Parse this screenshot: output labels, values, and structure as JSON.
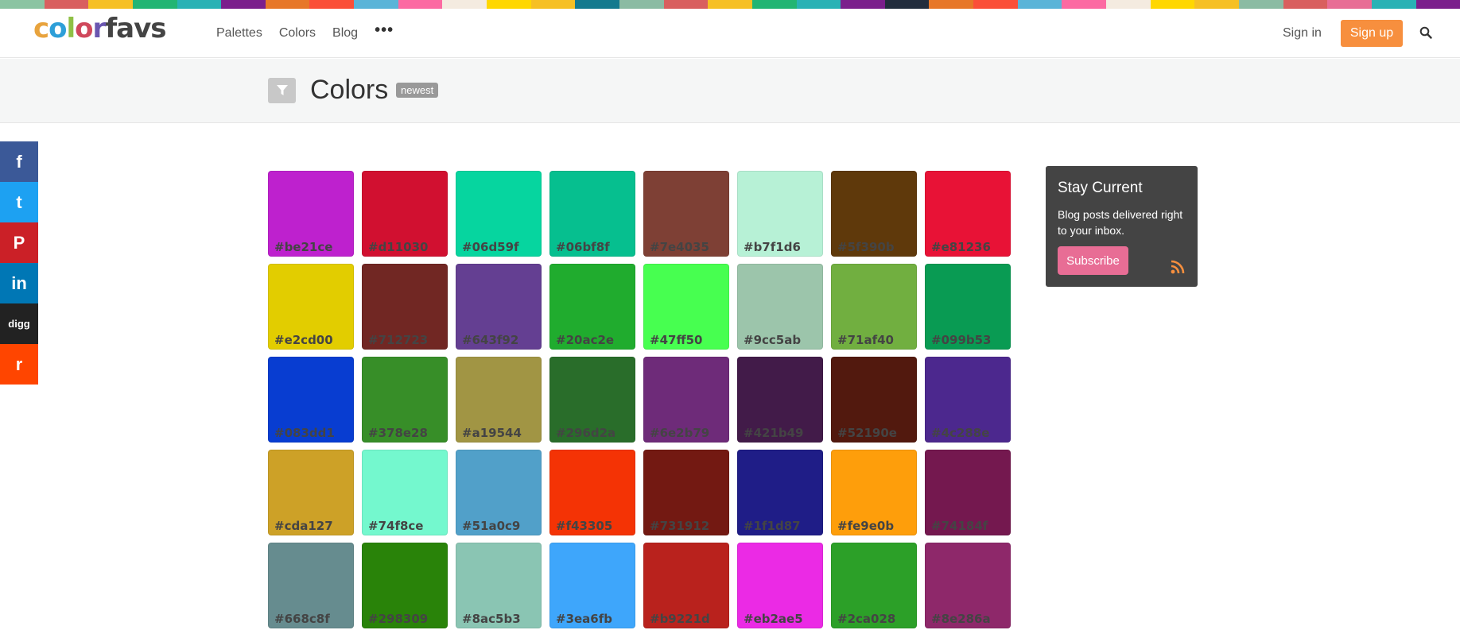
{
  "stripe_colors": [
    "#8bc4a2",
    "#d95f5f",
    "#f6c024",
    "#22b573",
    "#29b2b5",
    "#7b1f8c",
    "#e77728",
    "#fb4f38",
    "#5ab4d8",
    "#fc6aa2",
    "#f4ebe0",
    "#ffd700",
    "#f6c024",
    "#147a8e",
    "#8bbba3",
    "#d95f5f",
    "#f6c024",
    "#22b573",
    "#29b2b5",
    "#7b1f8c",
    "#222d3d",
    "#e77728",
    "#fb4f38",
    "#5ab4d8",
    "#fc6aa2",
    "#f4ebe0",
    "#ffd700",
    "#f6c024",
    "#8bbba3",
    "#d95f5f",
    "#e86d95",
    "#29b2b5",
    "#7b1f8c"
  ],
  "logo": {
    "letters": [
      {
        "ch": "c",
        "color": "#e8a33d"
      },
      {
        "ch": "o",
        "color": "#2e9fd8"
      },
      {
        "ch": "l",
        "color": "#8fc045"
      },
      {
        "ch": "o",
        "color": "#d0485c"
      },
      {
        "ch": "r",
        "color": "#6a56b0"
      },
      {
        "ch": "f",
        "color": "#444444"
      },
      {
        "ch": "a",
        "color": "#444444"
      },
      {
        "ch": "v",
        "color": "#444444"
      },
      {
        "ch": "s",
        "color": "#444444"
      }
    ]
  },
  "nav": {
    "palettes": "Palettes",
    "colors": "Colors",
    "blog": "Blog",
    "more": "•••",
    "signin": "Sign in",
    "signup": "Sign up",
    "search_icon": "search-icon"
  },
  "header": {
    "title": "Colors",
    "badge": "newest",
    "filter_icon": "filter-icon"
  },
  "social": [
    {
      "name": "facebook",
      "glyph": "f",
      "color": "#3b5998"
    },
    {
      "name": "twitter",
      "glyph": "t",
      "color": "#1da1f2"
    },
    {
      "name": "pinterest",
      "glyph": "P",
      "color": "#cb2027"
    },
    {
      "name": "linkedin",
      "glyph": "in",
      "color": "#0077b5"
    },
    {
      "name": "digg",
      "glyph": "digg",
      "color": "#222222"
    },
    {
      "name": "reddit",
      "glyph": "r",
      "color": "#ff4500"
    }
  ],
  "colors": [
    {
      "hex": "#be21ce",
      "label": "#be21ce"
    },
    {
      "hex": "#d11030",
      "label": "#d11030"
    },
    {
      "hex": "#06d59f",
      "label": "#06d59f"
    },
    {
      "hex": "#06bf8f",
      "label": "#06bf8f"
    },
    {
      "hex": "#7e4035",
      "label": "#7e4035"
    },
    {
      "hex": "#b7f1d6",
      "label": "#b7f1d6"
    },
    {
      "hex": "#5f390b",
      "label": "#5f390b"
    },
    {
      "hex": "#e81236",
      "label": "#e81236"
    },
    {
      "hex": "#e2cd00",
      "label": "#e2cd00"
    },
    {
      "hex": "#712723",
      "label": "#712723"
    },
    {
      "hex": "#643f92",
      "label": "#643f92"
    },
    {
      "hex": "#20ac2e",
      "label": "#20ac2e"
    },
    {
      "hex": "#47ff50",
      "label": "#47ff50"
    },
    {
      "hex": "#9cc5ab",
      "label": "#9cc5ab"
    },
    {
      "hex": "#71af40",
      "label": "#71af40"
    },
    {
      "hex": "#099b53",
      "label": "#099b53"
    },
    {
      "hex": "#083dd1",
      "label": "#083dd1"
    },
    {
      "hex": "#378e28",
      "label": "#378e28"
    },
    {
      "hex": "#a19544",
      "label": "#a19544"
    },
    {
      "hex": "#296d2a",
      "label": "#296d2a"
    },
    {
      "hex": "#6e2b79",
      "label": "#6e2b79"
    },
    {
      "hex": "#421b49",
      "label": "#421b49"
    },
    {
      "hex": "#52190e",
      "label": "#52190e"
    },
    {
      "hex": "#4c288e",
      "label": "#4c288e"
    },
    {
      "hex": "#cda127",
      "label": "#cda127"
    },
    {
      "hex": "#74f8ce",
      "label": "#74f8ce"
    },
    {
      "hex": "#51a0c9",
      "label": "#51a0c9"
    },
    {
      "hex": "#f43305",
      "label": "#f43305"
    },
    {
      "hex": "#731912",
      "label": "#731912"
    },
    {
      "hex": "#1f1d87",
      "label": "#1f1d87"
    },
    {
      "hex": "#fe9e0b",
      "label": "#fe9e0b"
    },
    {
      "hex": "#74184f",
      "label": "#74184f"
    },
    {
      "hex": "#668c8f",
      "label": "#668c8f"
    },
    {
      "hex": "#298309",
      "label": "#298309"
    },
    {
      "hex": "#8ac5b3",
      "label": "#8ac5b3"
    },
    {
      "hex": "#3ea6fb",
      "label": "#3ea6fb"
    },
    {
      "hex": "#b9221d",
      "label": "#b9221d"
    },
    {
      "hex": "#eb2ae5",
      "label": "#eb2ae5"
    },
    {
      "hex": "#2ca028",
      "label": "#2ca028"
    },
    {
      "hex": "#8e286a",
      "label": "#8e286a"
    }
  ],
  "card": {
    "title": "Stay Current",
    "text": "Blog posts delivered right to your inbox.",
    "button": "Subscribe",
    "rss_icon": "rss-icon",
    "rss_color": "#f78f3e"
  },
  "theme": {
    "accent": "#f78f3e",
    "card_bg": "#444444",
    "subscribe_bg": "#e86d95"
  }
}
